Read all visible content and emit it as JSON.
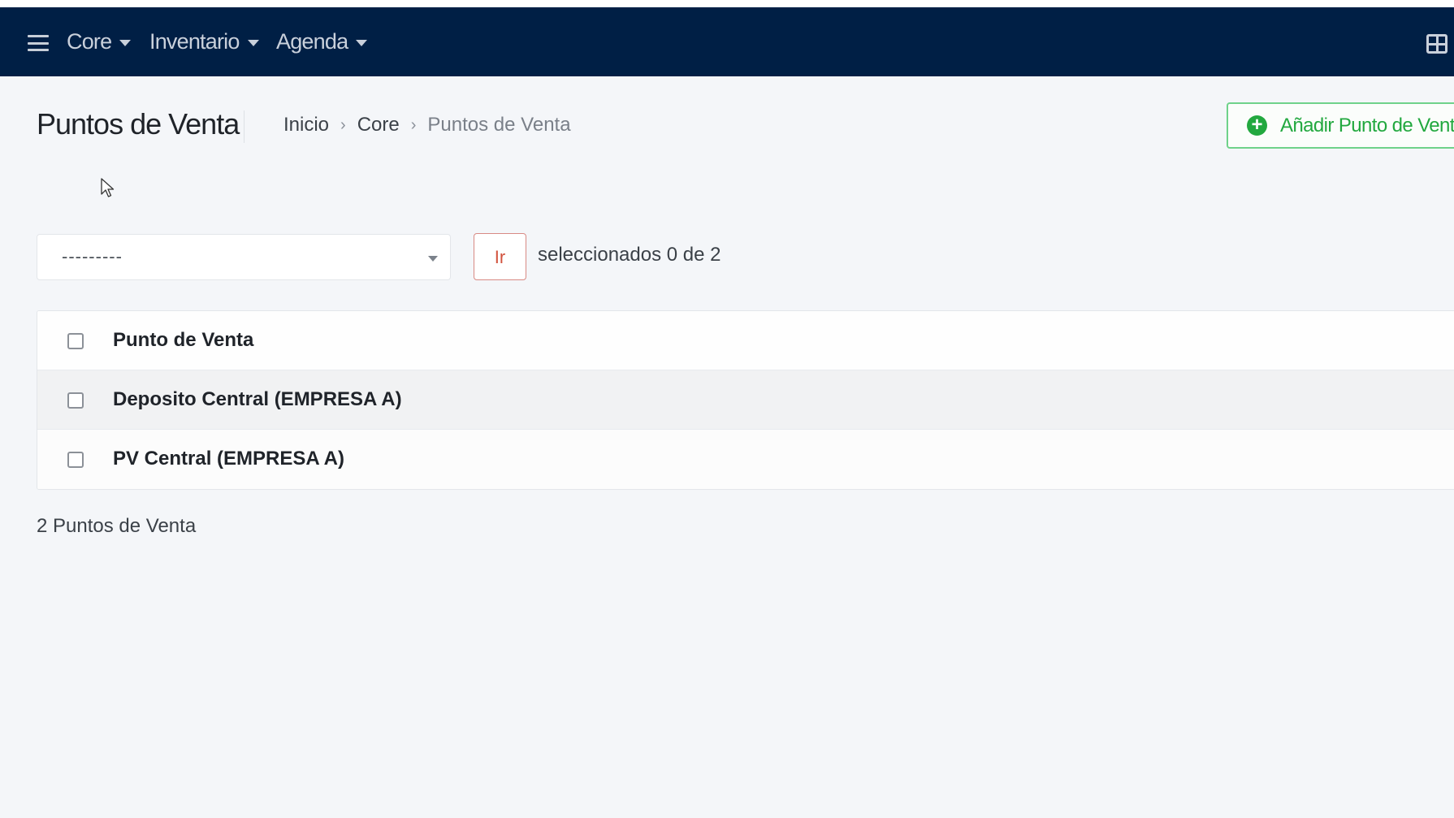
{
  "navbar": {
    "menus": [
      {
        "label": "Core"
      },
      {
        "label": "Inventario"
      },
      {
        "label": "Agenda"
      }
    ],
    "background_color": "#001f45"
  },
  "header": {
    "title": "Puntos de Venta",
    "breadcrumb": {
      "items": [
        "Inicio",
        "Core",
        "Puntos de Venta"
      ],
      "separator": "›"
    },
    "add_button_label": "Añadir Punto de Venta"
  },
  "actions": {
    "select_value": "---------",
    "go_label": "Ir",
    "selection_counter": "seleccionados 0 de 2"
  },
  "table": {
    "header": "Punto de Venta",
    "rows": [
      "Deposito Central (EMPRESA A)",
      "PV Central (EMPRESA A)"
    ]
  },
  "footer": {
    "count": "2 Puntos de Venta"
  },
  "colors": {
    "accent_green": "#22a83f",
    "go_button_red": "#d2533e"
  }
}
